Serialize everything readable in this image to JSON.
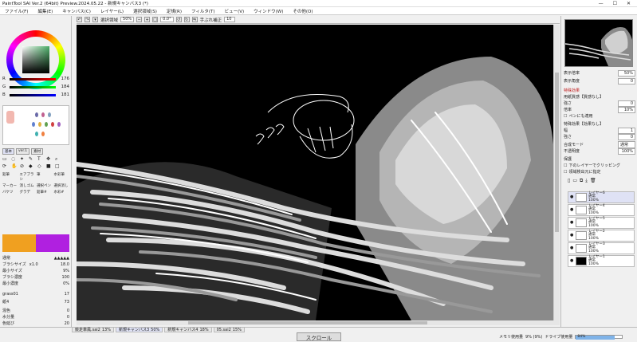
{
  "window": {
    "title": "PaintTool SAI Ver.2 (64bit) Preview.2024.05.22 - 新規キャンバス3 (*)",
    "min": "—",
    "max": "☐",
    "close": "✕"
  },
  "menu": [
    "ファイル(F)",
    "編集(E)",
    "キャンバス(C)",
    "レイヤー(L)",
    "選択領域(S)",
    "定規(R)",
    "フィルタ(T)",
    "ビュー(V)",
    "ウィンドウ(W)",
    "その他(O)"
  ],
  "toolbar": {
    "selection_label": "選択領域",
    "zoom": "50%",
    "angle": "0.0°",
    "stabilizer_label": "手ぶれ補正",
    "stabilizer": "10"
  },
  "color": {
    "r_label": "R",
    "g_label": "G",
    "b_label": "B",
    "r": "176",
    "g": "184",
    "b": "181"
  },
  "brush": {
    "size_label": "ブラシサイズ",
    "size_mult": "x1.0",
    "size": "18.0",
    "min_label": "最小サイズ",
    "min": "9%",
    "density_label": "ブラシ濃度",
    "density": "100",
    "min_density_label": "最小濃度",
    "min_density": "0%",
    "texture_name": "grass01",
    "texture_val": "17",
    "edge": "紙4",
    "edge_val": "73",
    "mix_label": "混色",
    "mix": "0",
    "water_label": "水分量",
    "water": "0",
    "persist_label": "色延び",
    "persist": "20",
    "keep_opacity": "不透明度を維持"
  },
  "tool_tabs": [
    "基本",
    "ver.1",
    "素材"
  ],
  "tools": [
    "鉛筆",
    "エアブラシ",
    "筆",
    "水彩筆",
    "マーカー",
    "消しゴム",
    "選択ペン",
    "選択消し",
    "バケツ",
    "グラデ",
    "鉛筆#",
    "水彩#"
  ],
  "navigator": {
    "zoom_label": "表示倍率",
    "zoom": "50%",
    "angle_label": "表示角度",
    "angle": "0"
  },
  "fx": {
    "header": "特殊効果",
    "paper_label": "用紙質感【質感なし】",
    "strength_label": "強さ",
    "strength": "0",
    "scale_label": "倍率",
    "scale": "10%",
    "pen_apply": "ペンにも適用",
    "effect_label": "特殊効果【効果なし】",
    "width_label": "幅",
    "width": "1",
    "eff_strength_label": "強さ",
    "eff_strength": "0"
  },
  "layer_opts": {
    "blend_label": "合成モード",
    "blend": "通常",
    "opacity_label": "不透明度",
    "opacity": "100%",
    "protect_label": "保護",
    "clip": "下のレイヤーでクリッピング",
    "ref": "領域検出元に指定"
  },
  "layers": [
    {
      "name": "レイヤー6",
      "mode": "通常",
      "opacity": "100%",
      "selected": true
    },
    {
      "name": "レイヤー4",
      "mode": "通常",
      "opacity": "100%",
      "selected": false
    },
    {
      "name": "レイヤー5",
      "mode": "通常",
      "opacity": "100%",
      "selected": false
    },
    {
      "name": "レイヤー2",
      "mode": "通常",
      "opacity": "100%",
      "selected": false
    },
    {
      "name": "レイヤー3",
      "mode": "通常",
      "opacity": "100%",
      "selected": false
    },
    {
      "name": "レイヤー1",
      "mode": "通常",
      "opacity": "100%",
      "selected": false
    }
  ],
  "files": [
    {
      "name": "競走車風.sai2",
      "pct": "13%",
      "active": false
    },
    {
      "name": "新規キャンバス3",
      "pct": "50%",
      "active": true
    },
    {
      "name": "新規キャンバス4",
      "pct": "18%",
      "active": false
    },
    {
      "name": "05.sai2",
      "pct": "15%",
      "active": false
    }
  ],
  "scroll_label": "スクロール",
  "status": {
    "mem_label": "メモリ使用量",
    "mem": "9% (9%)",
    "drive_label": "ドライブ使用量",
    "drive": "84%",
    "drive_fraction": 0.84
  }
}
